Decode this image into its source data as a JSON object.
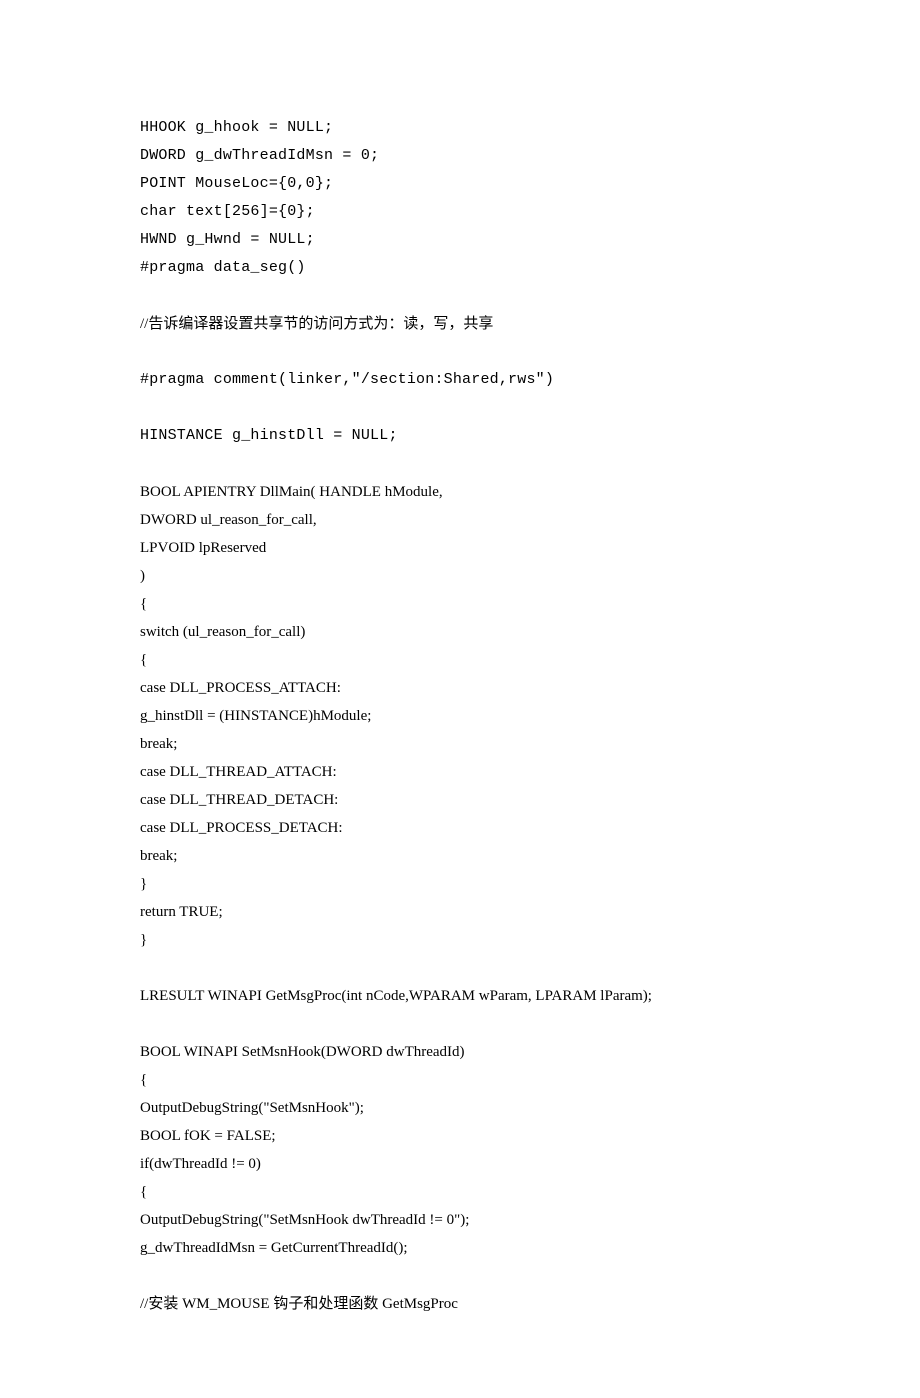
{
  "lines": [
    {
      "cls": "mono",
      "text": "HHOOK g_hhook = NULL;"
    },
    {
      "cls": "mono",
      "text": "DWORD g_dwThreadIdMsn = 0;"
    },
    {
      "cls": "mono",
      "text": "POINT MouseLoc={0,0};"
    },
    {
      "cls": "mono",
      "text": "char text[256]={0};"
    },
    {
      "cls": "mono",
      "text": "HWND g_Hwnd = NULL;"
    },
    {
      "cls": "mono",
      "text": "#pragma data_seg()"
    },
    {
      "cls": "spacer",
      "text": ""
    },
    {
      "cls": "cjk",
      "text": "//告诉编译器设置共享节的访问方式为：读，写，共享"
    },
    {
      "cls": "spacer",
      "text": ""
    },
    {
      "cls": "mono",
      "text": "#pragma comment(linker,\"/section:Shared,rws\")"
    },
    {
      "cls": "spacer",
      "text": ""
    },
    {
      "cls": "mono",
      "text": "HINSTANCE g_hinstDll = NULL;"
    },
    {
      "cls": "spacer",
      "text": ""
    },
    {
      "cls": "serif",
      "text": "BOOL APIENTRY DllMain( HANDLE hModule,"
    },
    {
      "cls": "serif",
      "text": "DWORD ul_reason_for_call,"
    },
    {
      "cls": "serif",
      "text": "LPVOID lpReserved"
    },
    {
      "cls": "serif",
      "text": ")"
    },
    {
      "cls": "serif",
      "text": "{"
    },
    {
      "cls": "serif",
      "text": "switch (ul_reason_for_call)"
    },
    {
      "cls": "serif",
      "text": "{"
    },
    {
      "cls": "serif",
      "text": "case DLL_PROCESS_ATTACH:"
    },
    {
      "cls": "serif",
      "text": "g_hinstDll = (HINSTANCE)hModule;"
    },
    {
      "cls": "serif",
      "text": "break;"
    },
    {
      "cls": "serif",
      "text": "case DLL_THREAD_ATTACH:"
    },
    {
      "cls": "serif",
      "text": "case DLL_THREAD_DETACH:"
    },
    {
      "cls": "serif",
      "text": "case DLL_PROCESS_DETACH:"
    },
    {
      "cls": "serif",
      "text": "break;"
    },
    {
      "cls": "serif",
      "text": "}"
    },
    {
      "cls": "serif",
      "text": "return TRUE;"
    },
    {
      "cls": "serif",
      "text": "}"
    },
    {
      "cls": "spacer",
      "text": ""
    },
    {
      "cls": "serif",
      "text": "LRESULT WINAPI GetMsgProc(int nCode,WPARAM wParam, LPARAM lParam);"
    },
    {
      "cls": "spacer",
      "text": ""
    },
    {
      "cls": "serif",
      "text": "BOOL WINAPI SetMsnHook(DWORD dwThreadId)"
    },
    {
      "cls": "serif",
      "text": "{"
    },
    {
      "cls": "serif",
      "text": "OutputDebugString(\"SetMsnHook\");"
    },
    {
      "cls": "serif",
      "text": "BOOL fOK = FALSE;"
    },
    {
      "cls": "serif",
      "text": "if(dwThreadId != 0)"
    },
    {
      "cls": "serif",
      "text": "{"
    },
    {
      "cls": "serif",
      "text": "OutputDebugString(\"SetMsnHook dwThreadId != 0\");"
    },
    {
      "cls": "serif",
      "text": "g_dwThreadIdMsn = GetCurrentThreadId();"
    },
    {
      "cls": "spacer",
      "text": ""
    },
    {
      "cls": "cjk",
      "text": "//安装 WM_MOUSE 钩子和处理函数 GetMsgProc"
    }
  ]
}
